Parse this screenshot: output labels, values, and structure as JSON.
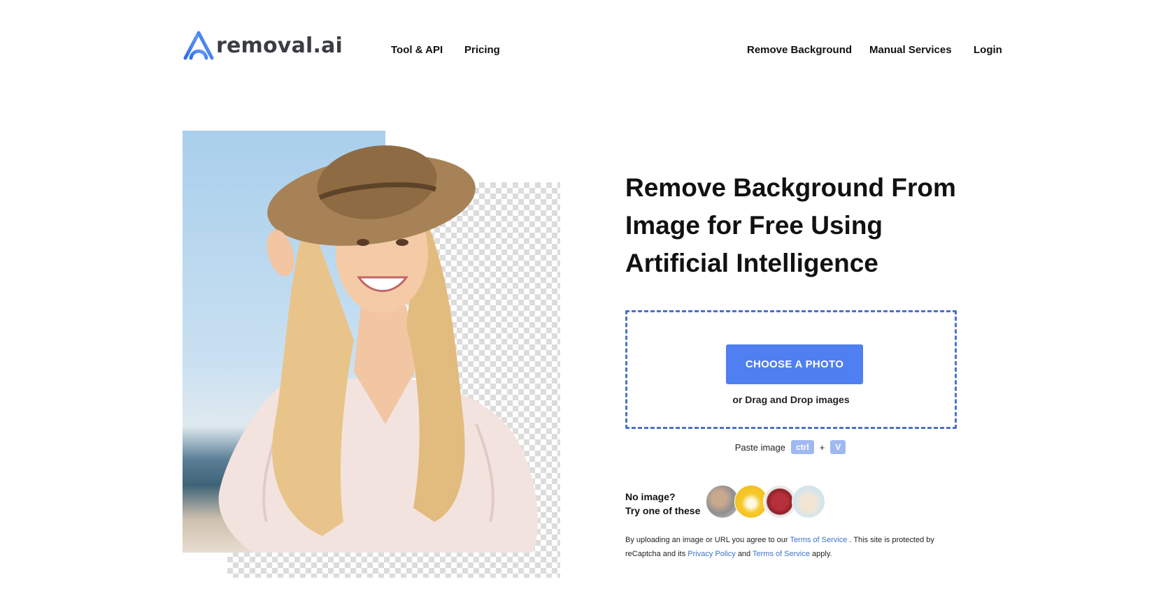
{
  "header": {
    "logo_text": "removal.ai",
    "nav_left": [
      "Tool & API",
      "Pricing"
    ],
    "nav_right": [
      "Remove Background",
      "Manual Services",
      "Login"
    ]
  },
  "hero": {
    "headline": "Remove Background From Image for Free Using Artificial Intelligence"
  },
  "upload": {
    "button_label": "CHOOSE A PHOTO",
    "drag_text": "or Drag and Drop images",
    "paste_label": "Paste image",
    "key_ctrl": "ctrl",
    "plus": "+",
    "key_v": "V"
  },
  "samples": {
    "line1": "No image?",
    "line2": "Try one of these",
    "items": [
      "sample-people-icon",
      "sample-car-icon",
      "sample-bag-icon",
      "sample-dog-icon"
    ]
  },
  "legal": {
    "t1": "By uploading an image or URL you agree to our",
    "link1": "Terms of Service",
    "t2": ". This site is protected by reCaptcha and its",
    "link2": "Privacy Policy",
    "t3": "and",
    "link3": "Terms of Service",
    "t4": "apply."
  },
  "colors": {
    "accent": "#4f7ff0",
    "dropzone_border": "#4b73c6",
    "link": "#3d72c9",
    "kbd": "#9fb8f1"
  }
}
